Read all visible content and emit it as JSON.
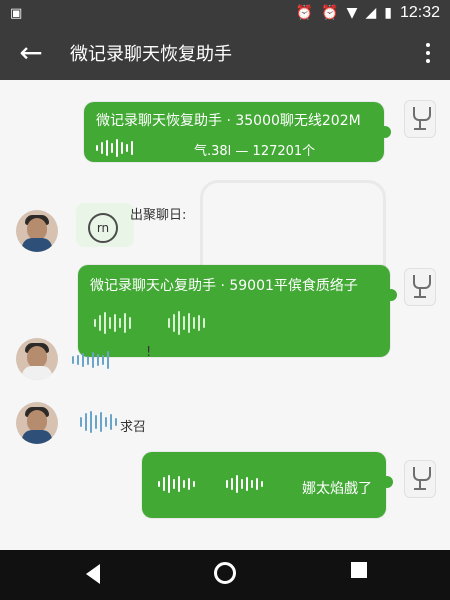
{
  "status_bar": {
    "time": "12:32",
    "left_icon": "image-icon"
  },
  "app_bar": {
    "title": "微记录聊天恢复助手"
  },
  "messages": [
    {
      "side": "right",
      "line1": "微记录聊天恢复助手 · 35000聊无线202M",
      "line2": "气.38l — 127201个"
    },
    {
      "side": "left",
      "text": "出聚聊日:"
    },
    {
      "side": "right",
      "line1": "微记录聊天心复助手 · 59001平傧食质络子"
    },
    {
      "side": "left",
      "text": "!"
    },
    {
      "side": "left",
      "text": "求召"
    },
    {
      "side": "right",
      "text": "娜太焰戲了"
    }
  ]
}
